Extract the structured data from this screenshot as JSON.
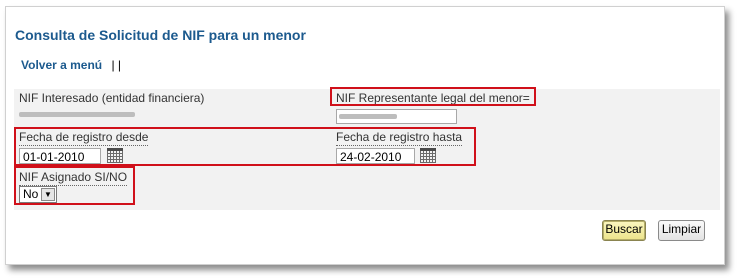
{
  "page": {
    "title": "Consulta de Solicitud de NIF para un menor",
    "back_link": "Volver a menú",
    "separators": "| |"
  },
  "form": {
    "nif_interesado_label": "NIF Interesado (entidad financiera)",
    "nif_representante_label": "NIF Representante legal del menor=",
    "fecha_desde_label": "Fecha de registro desde",
    "fecha_desde_value": "01-01-2010",
    "fecha_hasta_label": "Fecha de registro hasta",
    "fecha_hasta_value": "24-02-2010",
    "nif_asignado_label": "NIF Asignado SI/NO",
    "nif_asignado_value": "No"
  },
  "buttons": {
    "buscar": "Buscar",
    "limpiar": "Limpiar"
  },
  "icons": {
    "calendar": "calendar-icon",
    "dropdown": "chevron-down-icon"
  },
  "colors": {
    "title": "#1c5a8e",
    "highlight": "#d0101a",
    "form_bg": "#f2f2f2",
    "primary_button": "#ece48a"
  }
}
